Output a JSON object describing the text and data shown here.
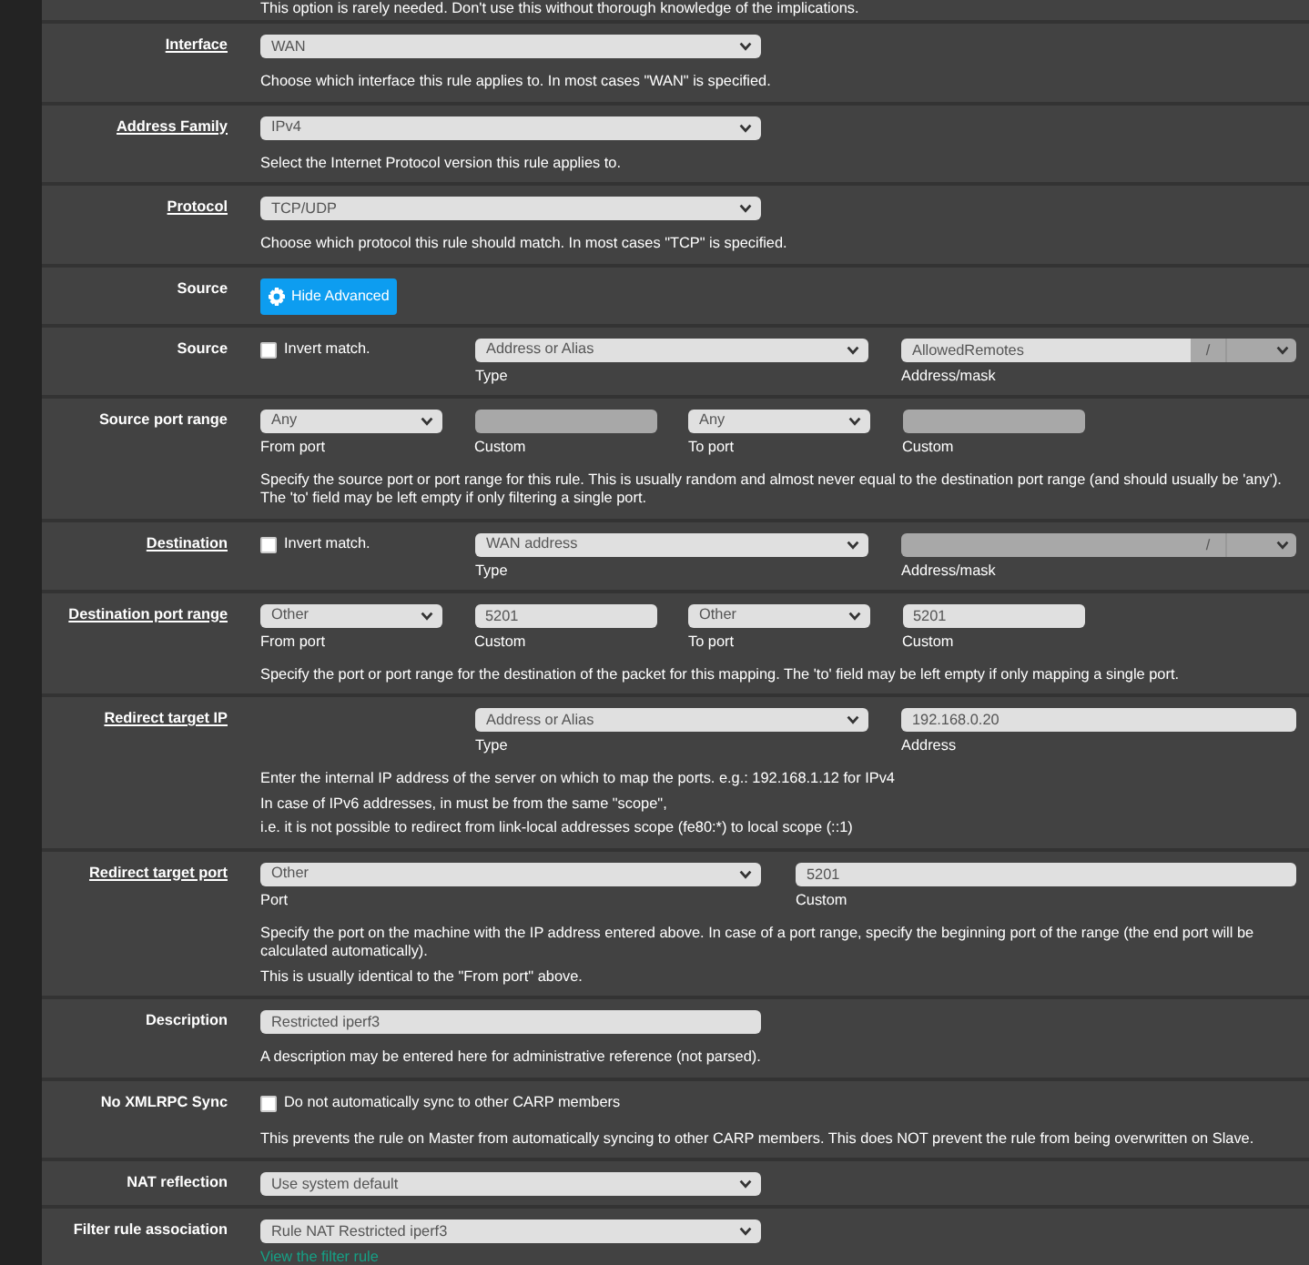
{
  "notice": "This option is rarely needed. Don't use this without thorough knowledge of the implications.",
  "rows": [
    {
      "label": "Interface",
      "linked": true,
      "kind": "wide",
      "controls": [
        {
          "kind": "select",
          "value": "WAN"
        }
      ],
      "help": [
        "Choose which interface this rule applies to. In most cases \"WAN\" is specified."
      ]
    },
    {
      "label": "Address Family",
      "linked": true,
      "kind": "wide",
      "controls": [
        {
          "kind": "select",
          "value": "IPv4"
        }
      ],
      "help": [
        "Select the Internet Protocol version this rule applies to."
      ]
    },
    {
      "label": "Protocol",
      "linked": true,
      "kind": "wide",
      "controls": [
        {
          "kind": "select",
          "value": "TCP/UDP"
        }
      ],
      "help": [
        "Choose which protocol this rule should match. In most cases \"TCP\" is specified."
      ]
    },
    {
      "label": "Source",
      "linked": false,
      "kind": "wide",
      "controls": [
        {
          "kind": "button",
          "value": "Hide Advanced"
        }
      ]
    },
    {
      "label": "Source",
      "linked": false,
      "kind": "address",
      "controls": [
        {
          "kind": "checkbox",
          "value": "Invert match.",
          "checked": false
        },
        {
          "kind": "select",
          "value": "Address or Alias",
          "caption": "Type"
        },
        {
          "kind": "mask",
          "value": "AllowedRemotes",
          "separator": "/",
          "caption": "Address/mask",
          "disabled": false
        }
      ]
    },
    {
      "label": "Source port range",
      "linked": false,
      "kind": "quad",
      "controls": [
        {
          "kind": "select",
          "value": "Any",
          "caption": "From port"
        },
        {
          "kind": "input",
          "caption": "Custom",
          "disabled": true
        },
        {
          "kind": "select",
          "value": "Any",
          "caption": "To port"
        },
        {
          "kind": "input",
          "caption": "Custom",
          "disabled": true
        }
      ],
      "help": [
        "Specify the source port or port range for this rule. This is usually random and almost never equal to the destination port range (and should usually be 'any'). The 'to' field may be left empty if only filtering a single port."
      ]
    },
    {
      "label": "Destination",
      "linked": true,
      "kind": "address",
      "controls": [
        {
          "kind": "checkbox",
          "value": "Invert match.",
          "checked": false
        },
        {
          "kind": "select",
          "value": "WAN address",
          "caption": "Type"
        },
        {
          "kind": "mask",
          "separator": "/",
          "caption": "Address/mask",
          "disabled": true
        }
      ]
    },
    {
      "label": "Destination port range",
      "linked": true,
      "kind": "quad",
      "controls": [
        {
          "kind": "select",
          "value": "Other",
          "caption": "From port"
        },
        {
          "kind": "input",
          "value": "5201",
          "caption": "Custom",
          "disabled": false
        },
        {
          "kind": "select",
          "value": "Other",
          "caption": "To port"
        },
        {
          "kind": "input",
          "value": "5201",
          "caption": "Custom",
          "disabled": false
        }
      ],
      "help": [
        "Specify the port or port range for the destination of the packet for this mapping. The 'to' field may be left empty if only mapping a single port."
      ]
    },
    {
      "label": "Redirect target IP",
      "linked": true,
      "kind": "address",
      "controls": [
        {
          "kind": "blank"
        },
        {
          "kind": "select",
          "value": "Address or Alias",
          "caption": "Type"
        },
        {
          "kind": "input",
          "value": "192.168.0.20",
          "caption": "Address",
          "disabled": false
        }
      ],
      "help": [
        "Enter the internal IP address of the server on which to map the ports. e.g.: 192.168.1.12 for IPv4",
        "In case of IPv6 addresses, in must be from the same \"scope\",",
        "i.e. it is not possible to redirect from link-local addresses scope (fe80:*) to local scope (::1)"
      ]
    },
    {
      "label": "Redirect target port",
      "linked": true,
      "kind": "pair",
      "controls": [
        {
          "kind": "select",
          "value": "Other",
          "caption": "Port"
        },
        {
          "kind": "input",
          "value": "5201",
          "caption": "Custom",
          "disabled": false
        }
      ],
      "help": [
        "Specify the port on the machine with the IP address entered above. In case of a port range, specify the beginning port of the range (the end port will be calculated automatically).",
        "This is usually identical to the \"From port\" above."
      ]
    },
    {
      "label": "Description",
      "linked": false,
      "kind": "wide",
      "controls": [
        {
          "kind": "input",
          "value": "Restricted iperf3",
          "disabled": false
        }
      ],
      "help": [
        "A description may be entered here for administrative reference (not parsed)."
      ]
    },
    {
      "label": "No XMLRPC Sync",
      "linked": false,
      "kind": "wide",
      "controls": [
        {
          "kind": "checkbox",
          "value": "Do not automatically sync to other CARP members",
          "checked": false
        }
      ],
      "help": [
        "This prevents the rule on Master from automatically syncing to other CARP members. This does NOT prevent the rule from being overwritten on Slave."
      ]
    },
    {
      "label": "NAT reflection",
      "linked": false,
      "kind": "wide",
      "controls": [
        {
          "kind": "select",
          "value": "Use system default"
        }
      ]
    },
    {
      "label": "Filter rule association",
      "linked": false,
      "kind": "wide",
      "controls": [
        {
          "kind": "select",
          "value": "Rule NAT Restricted iperf3"
        },
        {
          "kind": "link",
          "value": "View the filter rule"
        }
      ]
    }
  ]
}
